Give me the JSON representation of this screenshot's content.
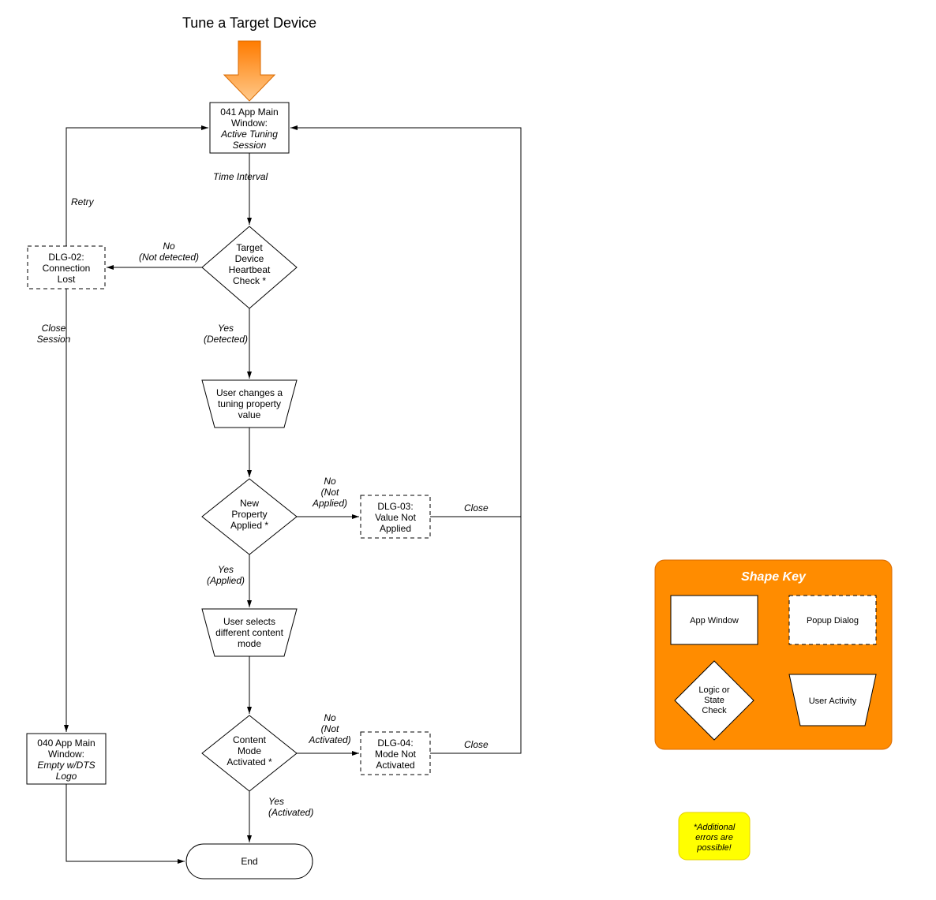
{
  "title": "Tune a Target Device",
  "nodes": {
    "n041": {
      "line1": "041 App Main",
      "line2": "Window:",
      "line3": "Active Tuning",
      "line4": "Session"
    },
    "heartbeat": {
      "line1": "Target",
      "line2": "Device",
      "line3": "Heartbeat",
      "line4": "Check *"
    },
    "dlg02": {
      "line1": "DLG-02:",
      "line2": "Connection",
      "line3": "Lost"
    },
    "userChange": {
      "line1": "User changes a",
      "line2": "tuning property",
      "line3": "value"
    },
    "propApplied": {
      "line1": "New",
      "line2": "Property",
      "line3": "Applied *"
    },
    "dlg03": {
      "line1": "DLG-03:",
      "line2": "Value Not",
      "line3": "Applied"
    },
    "userSelect": {
      "line1": "User selects",
      "line2": "different content",
      "line3": "mode"
    },
    "modeActivated": {
      "line1": "Content",
      "line2": "Mode",
      "line3": "Activated *"
    },
    "dlg04": {
      "line1": "DLG-04:",
      "line2": "Mode Not",
      "line3": "Activated"
    },
    "n040": {
      "line1": "040 App Main",
      "line2": "Window:",
      "line3": "Empty w/DTS",
      "line4": "Logo"
    },
    "end": "End"
  },
  "edgeLabels": {
    "timeInterval": "Time Interval",
    "noNotDetected": {
      "l1": "No",
      "l2": "(Not detected)"
    },
    "yesDetected": {
      "l1": "Yes",
      "l2": "(Detected)"
    },
    "retry": "Retry",
    "closeSession": {
      "l1": "Close",
      "l2": "Session"
    },
    "noNotApplied": {
      "l1": "No",
      "l2": "(Not",
      "l3": "Applied)"
    },
    "yesApplied": {
      "l1": "Yes",
      "l2": "(Applied)"
    },
    "close1": "Close",
    "noNotActivated": {
      "l1": "No",
      "l2": "(Not",
      "l3": "Activated)"
    },
    "yesActivated": {
      "l1": "Yes",
      "l2": "(Activated)"
    },
    "close2": "Close"
  },
  "key": {
    "title": "Shape Key",
    "appWindow": "App Window",
    "popupDialog": "Popup Dialog",
    "logicCheck": {
      "l1": "Logic or",
      "l2": "State",
      "l3": "Check"
    },
    "userActivity": "User Activity"
  },
  "note": {
    "l1": "*Additional",
    "l2": "errors are",
    "l3": "possible!"
  }
}
